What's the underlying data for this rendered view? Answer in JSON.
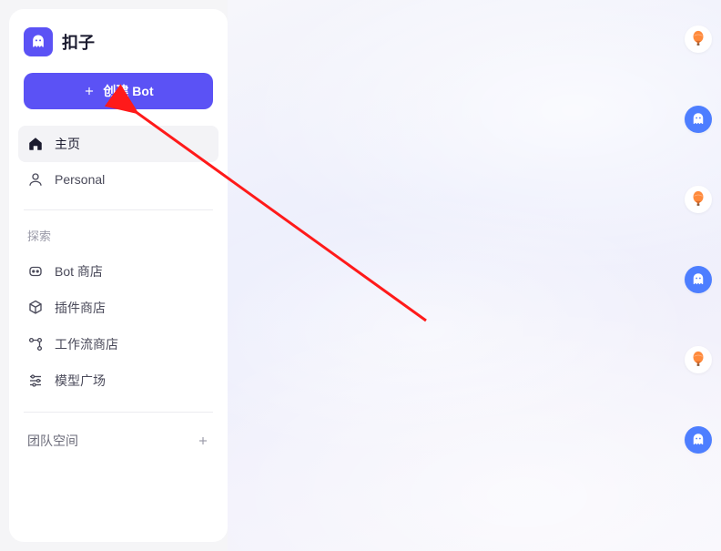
{
  "brand": {
    "name": "扣子"
  },
  "create_button": {
    "label": "创建 Bot"
  },
  "nav": {
    "home": "主页",
    "personal": "Personal"
  },
  "explore": {
    "section_label": "探索",
    "bot_store": "Bot 商店",
    "plugin_store": "插件商店",
    "workflow_store": "工作流商店",
    "model_plaza": "模型广场"
  },
  "team_space": {
    "label": "团队空间"
  },
  "right_rail": {
    "items": [
      {
        "type": "balloon"
      },
      {
        "type": "bot"
      },
      {
        "type": "balloon"
      },
      {
        "type": "bot"
      },
      {
        "type": "balloon"
      },
      {
        "type": "bot"
      }
    ]
  },
  "colors": {
    "primary": "#5b52f5",
    "bot_blue": "#4d7eff",
    "arrow": "#ff1a1a"
  }
}
